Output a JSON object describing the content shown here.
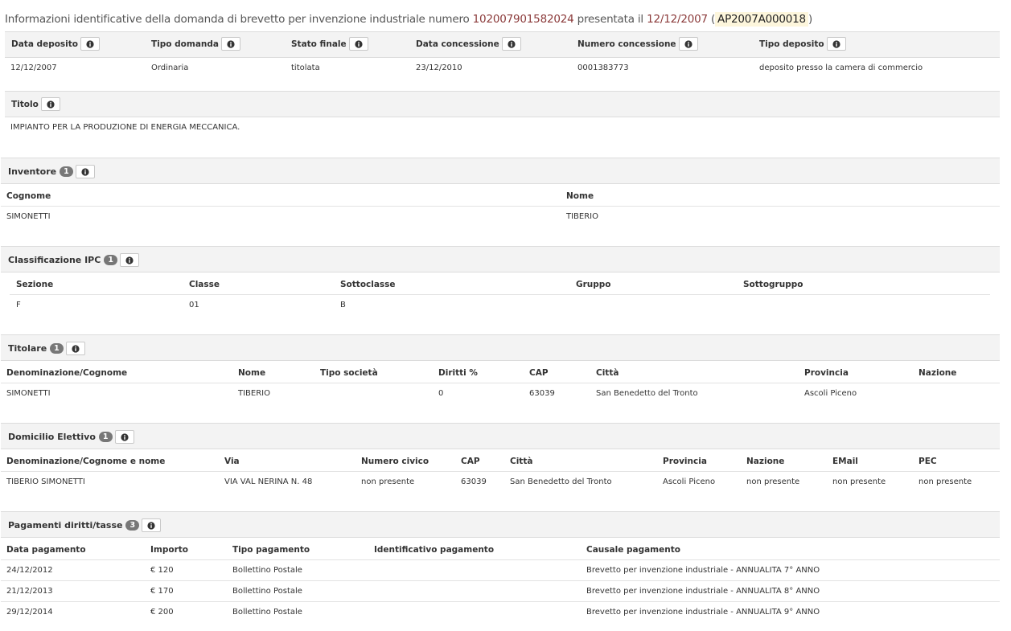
{
  "header": {
    "prefix": "Informazioni identificative della domanda di brevetto per invenzione industriale numero",
    "number": "102007901582024",
    "presented": "presentata il",
    "date": "12/12/2007",
    "code": "AP2007A000018",
    "open_paren": "(",
    "close_paren": ")"
  },
  "general": {
    "headers": [
      "Data deposito",
      "Tipo domanda",
      "Stato finale",
      "Data concessione",
      "Numero concessione",
      "Tipo deposito"
    ],
    "values": [
      "12/12/2007",
      "Ordinaria",
      "titolata",
      "23/12/2010",
      "0001383773",
      "deposito presso la camera di commercio"
    ]
  },
  "titolo": {
    "label": "Titolo",
    "value": "IMPIANTO PER LA PRODUZIONE DI ENERGIA MECCANICA."
  },
  "inventore": {
    "label": "Inventore",
    "count": "1",
    "headers": [
      "Cognome",
      "Nome"
    ],
    "rows": [
      [
        "SIMONETTI",
        "TIBERIO"
      ]
    ]
  },
  "ipc": {
    "label": "Classificazione IPC",
    "count": "1",
    "headers": [
      "Sezione",
      "Classe",
      "Sottoclasse",
      "Gruppo",
      "Sottogruppo"
    ],
    "rows": [
      [
        "F",
        "01",
        "B",
        "",
        ""
      ]
    ]
  },
  "titolare": {
    "label": "Titolare",
    "count": "1",
    "headers": [
      "Denominazione/Cognome",
      "Nome",
      "Tipo società",
      "Diritti %",
      "CAP",
      "Città",
      "Provincia",
      "Nazione"
    ],
    "rows": [
      [
        "SIMONETTI",
        "TIBERIO",
        "",
        "0",
        "63039",
        "San Benedetto del Tronto",
        "Ascoli Piceno",
        ""
      ]
    ]
  },
  "domicilio": {
    "label": "Domicilio Elettivo",
    "count": "1",
    "headers": [
      "Denominazione/Cognome e nome",
      "Via",
      "Numero civico",
      "CAP",
      "Città",
      "Provincia",
      "Nazione",
      "EMail",
      "PEC"
    ],
    "rows": [
      [
        "TIBERIO SIMONETTI",
        "VIA VAL NERINA N. 48",
        "non presente",
        "63039",
        "San Benedetto del Tronto",
        "Ascoli Piceno",
        "non presente",
        "non presente",
        "non presente"
      ]
    ]
  },
  "pagamenti": {
    "label": "Pagamenti diritti/tasse",
    "count": "3",
    "headers": [
      "Data pagamento",
      "Importo",
      "Tipo pagamento",
      "Identificativo pagamento",
      "Causale pagamento"
    ],
    "rows": [
      [
        "24/12/2012",
        "€ 120",
        "Bollettino Postale",
        "",
        "Brevetto per invenzione industriale - ANNUALITA 7° ANNO"
      ],
      [
        "21/12/2013",
        "€ 170",
        "Bollettino Postale",
        "",
        "Brevetto per invenzione industriale - ANNUALITA 8° ANNO"
      ],
      [
        "29/12/2014",
        "€ 200",
        "Bollettino Postale",
        "",
        "Brevetto per invenzione industriale - ANNUALITA 9° ANNO"
      ]
    ]
  }
}
